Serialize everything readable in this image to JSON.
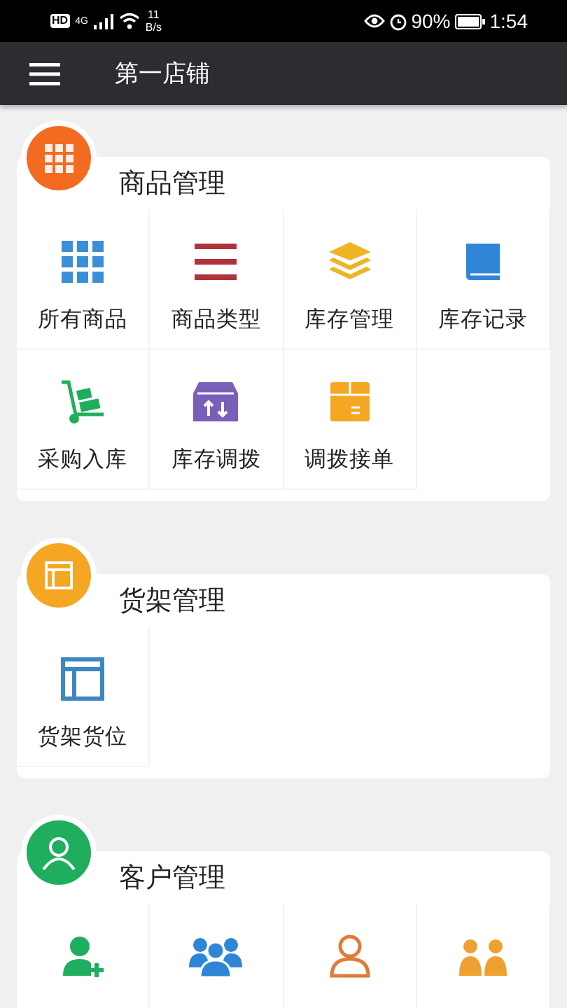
{
  "status_bar": {
    "hd": "HD",
    "network": "4G",
    "speed_value": "11",
    "speed_unit": "B/s",
    "battery": "90%",
    "time": "1:54"
  },
  "app_bar": {
    "title": "第一店铺"
  },
  "sections": [
    {
      "title": "商品管理",
      "color": "#f26b21",
      "items": [
        {
          "label": "所有商品"
        },
        {
          "label": "商品类型"
        },
        {
          "label": "库存管理"
        },
        {
          "label": "库存记录"
        },
        {
          "label": "采购入库"
        },
        {
          "label": "库存调拨"
        },
        {
          "label": "调拨接单"
        }
      ]
    },
    {
      "title": "货架管理",
      "color": "#f5a623",
      "items": [
        {
          "label": "货架货位"
        }
      ]
    },
    {
      "title": "客户管理",
      "color": "#1fae5e"
    }
  ]
}
